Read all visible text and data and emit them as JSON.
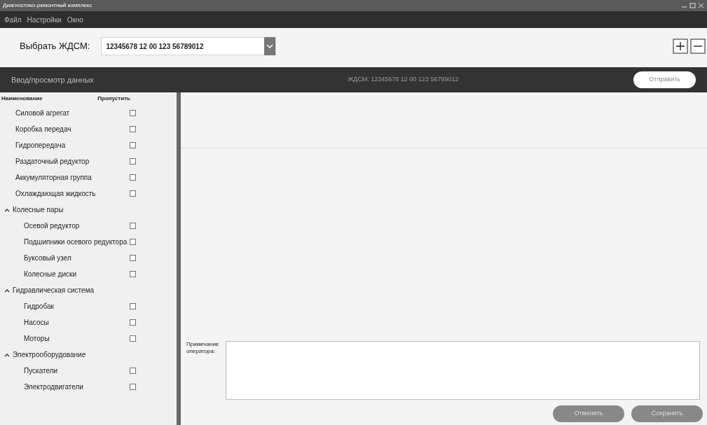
{
  "window": {
    "title": "Диагностико-ремонтный комплекс"
  },
  "menu": [
    "Файл",
    "Настройки",
    "Окно"
  ],
  "selector": {
    "label": "Выбрать ЖДСМ:",
    "value": "12345678 12 00 123 56789012"
  },
  "header": {
    "title": "Ввод/просмотр данных",
    "subtitle": "ЖДСМ: 12345678 12 00 123 56789012",
    "button": "Отправить"
  },
  "tree": {
    "columns": [
      "Наименование",
      "Пропустить"
    ],
    "items": [
      {
        "label": "Силовой агрегат",
        "checked": false
      },
      {
        "label": "Коробка передач",
        "checked": false
      },
      {
        "label": "Гидропередача",
        "checked": false
      },
      {
        "label": "Раздаточный редуктор",
        "checked": false
      },
      {
        "label": "Аккумуляторная группа",
        "checked": false
      },
      {
        "label": "Охлаждающая жидкость",
        "checked": false
      },
      {
        "label": "Колесные пары",
        "expanded": true,
        "children": [
          {
            "label": "Осевой редуктор",
            "checked": false
          },
          {
            "label": "Подшипники осевого редуктора",
            "checked": false
          },
          {
            "label": "Буксовый узел",
            "checked": false
          },
          {
            "label": "Колесные диски",
            "checked": false
          }
        ]
      },
      {
        "label": "Гидравлическая система",
        "expanded": true,
        "children": [
          {
            "label": "Гидробак",
            "checked": false
          },
          {
            "label": "Насосы",
            "checked": false
          },
          {
            "label": "Моторы",
            "checked": false
          }
        ]
      },
      {
        "label": "Электрооборудование",
        "expanded": true,
        "children": [
          {
            "label": "Пускатели",
            "checked": false
          },
          {
            "label": "Электродвигатели",
            "checked": false
          }
        ]
      }
    ]
  },
  "note": {
    "label": "Примечание оператора:"
  },
  "buttons": [
    "Отменить",
    "Сохранить"
  ]
}
